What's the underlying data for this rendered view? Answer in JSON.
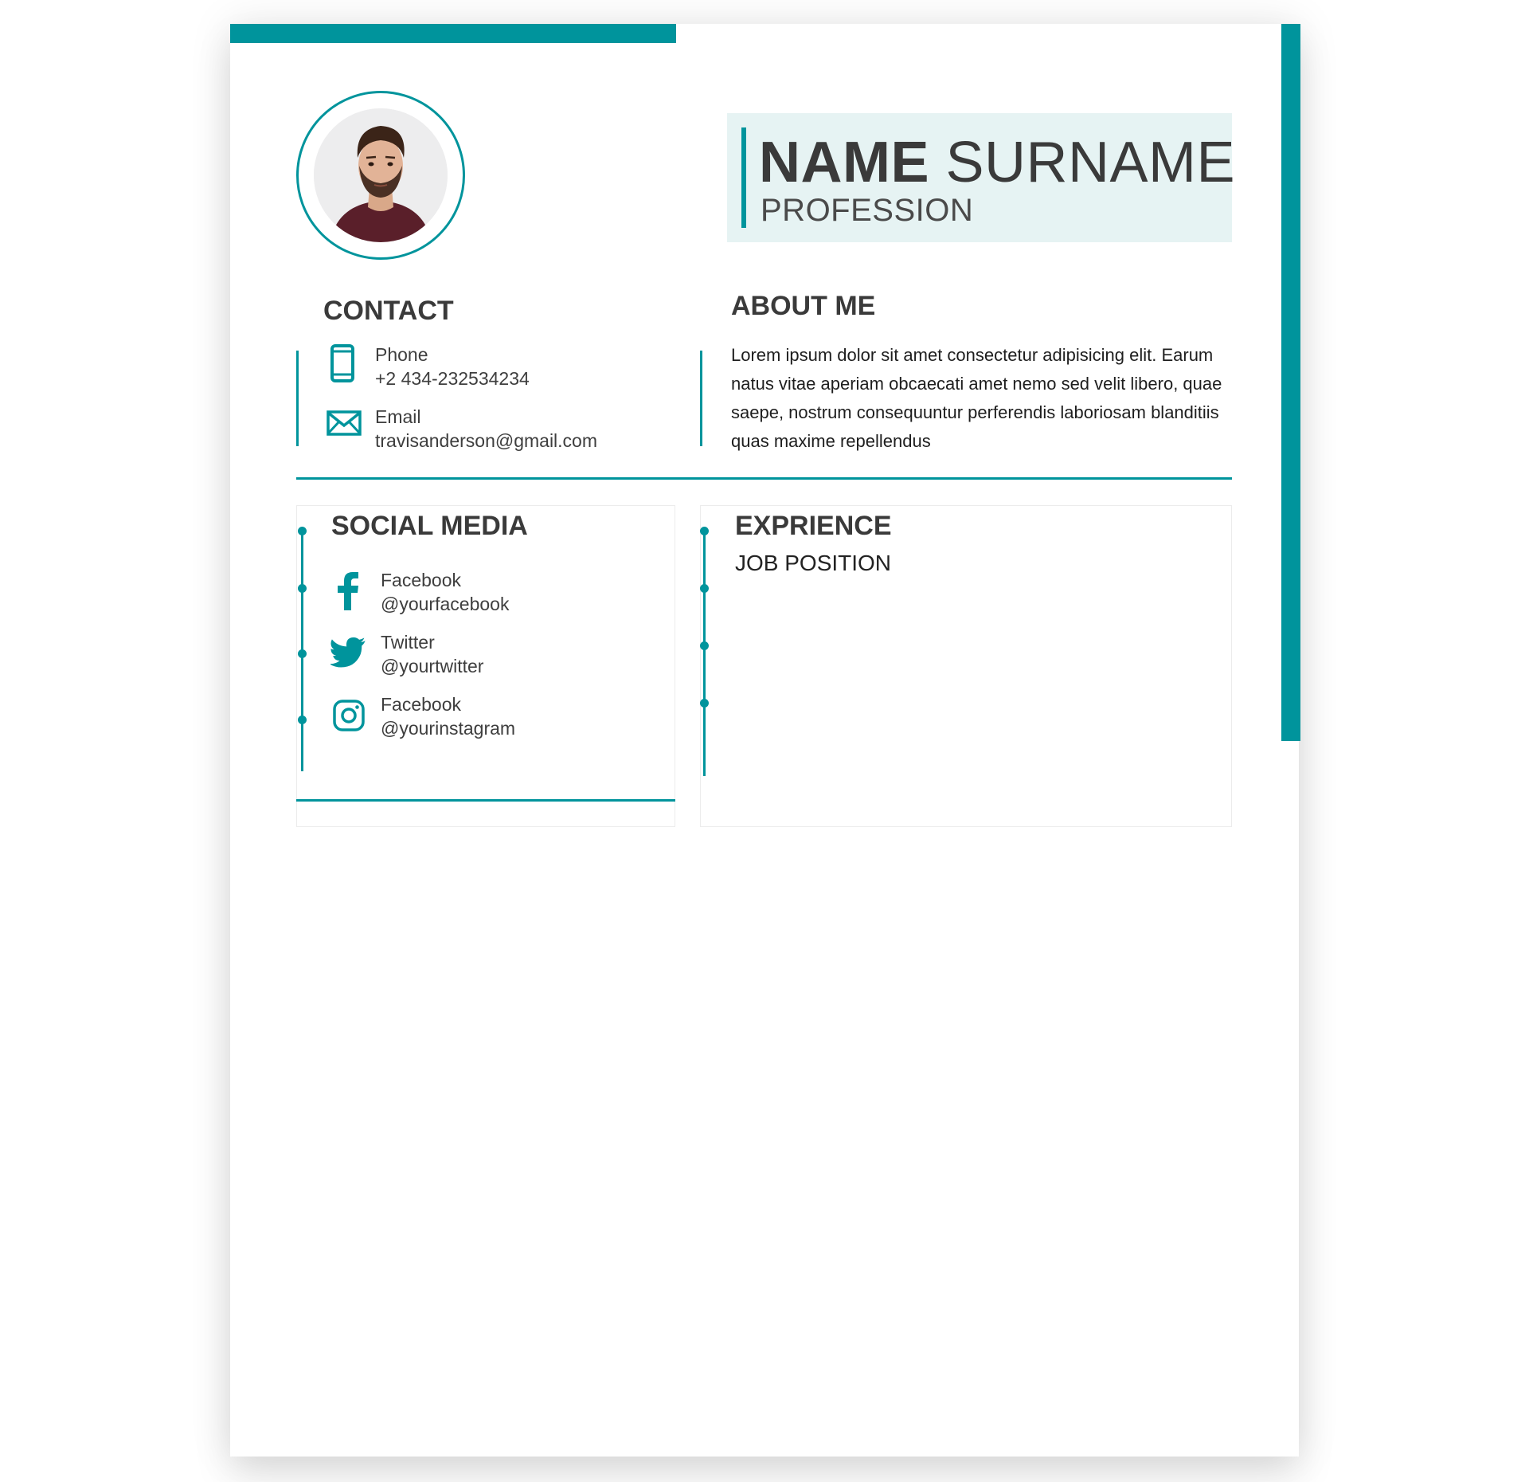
{
  "colors": {
    "accent": "#00949c",
    "name_box_bg": "#e6f3f3",
    "text": "#3a3a3a"
  },
  "header": {
    "name_first": "NAME",
    "name_last": "SURNAME",
    "profession": "PROFESSION"
  },
  "contact": {
    "title": "CONTACT",
    "items": [
      {
        "icon": "phone-icon",
        "label": "Phone",
        "value": "+2 434-232534234"
      },
      {
        "icon": "email-icon",
        "label": "Email",
        "value": "travisanderson@gmail.com"
      }
    ]
  },
  "about": {
    "title": "ABOUT ME",
    "text": "Lorem ipsum dolor sit amet consectetur adipisicing elit. Earum natus vitae aperiam obcaecati amet nemo sed velit libero, quae saepe, nostrum consequuntur perferendis laboriosam blanditiis quas maxime repellendus"
  },
  "social": {
    "title": "SOCIAL MEDIA",
    "items": [
      {
        "icon": "facebook-icon",
        "label": "Facebook",
        "handle": "@yourfacebook"
      },
      {
        "icon": "twitter-icon",
        "label": "Twitter",
        "handle": "@yourtwitter"
      },
      {
        "icon": "instagram-icon",
        "label": "Facebook",
        "handle": "@yourinstagram"
      }
    ]
  },
  "experience": {
    "title": "EXPRIENCE",
    "job_position": "JOB POSITION"
  }
}
